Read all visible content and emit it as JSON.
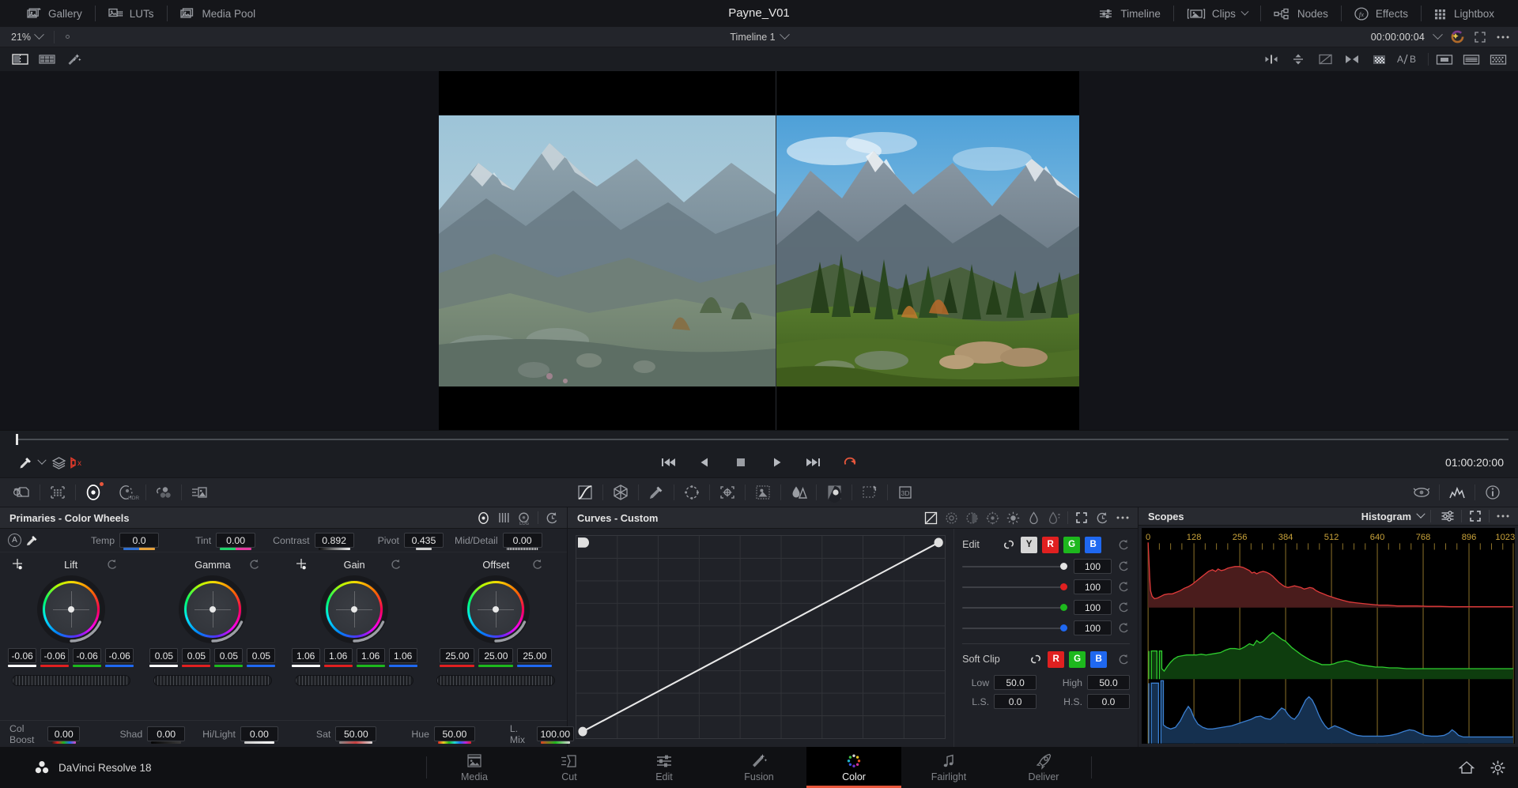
{
  "topbar": {
    "items": [
      {
        "label": "Gallery",
        "icon": "gallery-icon"
      },
      {
        "label": "LUTs",
        "icon": "luts-icon"
      },
      {
        "label": "Media Pool",
        "icon": "media-pool-icon"
      }
    ],
    "project_title": "Payne_V01",
    "right_items": [
      {
        "label": "Timeline",
        "icon": "timeline-icon"
      },
      {
        "label": "Clips",
        "icon": "clips-icon",
        "chevron": true
      },
      {
        "label": "Nodes",
        "icon": "nodes-icon"
      },
      {
        "label": "Effects",
        "icon": "effects-fx-icon"
      },
      {
        "label": "Lightbox",
        "icon": "lightbox-grid-icon"
      }
    ]
  },
  "bar2": {
    "zoom_level": "21%",
    "timeline_name": "Timeline 1",
    "timecode": "00:00:00:04"
  },
  "viewer": {
    "timecode_right": "01:00:20:00"
  },
  "primaries": {
    "title": "Primaries - Color Wheels",
    "mode_label": "A",
    "controls": [
      {
        "name": "Temp",
        "value": "0.0",
        "bar": "temp"
      },
      {
        "name": "Tint",
        "value": "0.00",
        "bar": "tint"
      },
      {
        "name": "Contrast",
        "value": "0.892",
        "bar": "mono"
      },
      {
        "name": "Pivot",
        "value": "0.435",
        "bar": "mono"
      },
      {
        "name": "Mid/Detail",
        "value": "0.00",
        "bar": "ribbed"
      }
    ],
    "wheels": [
      {
        "name": "Lift",
        "values": [
          "-0.06",
          "-0.06",
          "-0.06",
          "-0.06"
        ],
        "colors": [
          "#ffffff",
          "#e02020",
          "#1db81d",
          "#1f68f0"
        ],
        "crosshair": true
      },
      {
        "name": "Gamma",
        "values": [
          "0.05",
          "0.05",
          "0.05",
          "0.05"
        ],
        "colors": [
          "#ffffff",
          "#e02020",
          "#1db81d",
          "#1f68f0"
        ],
        "crosshair": false
      },
      {
        "name": "Gain",
        "values": [
          "1.06",
          "1.06",
          "1.06",
          "1.06"
        ],
        "colors": [
          "#ffffff",
          "#e02020",
          "#1db81d",
          "#1f68f0"
        ],
        "crosshair": true
      },
      {
        "name": "Offset",
        "values": [
          "25.00",
          "25.00",
          "25.00"
        ],
        "colors": [
          "#e02020",
          "#1db81d",
          "#1f68f0"
        ],
        "crosshair": false
      }
    ],
    "bottom_controls": [
      {
        "name": "Col Boost",
        "value": "0.00",
        "bar": "rainbow"
      },
      {
        "name": "Shad",
        "value": "0.00",
        "bar": "dark"
      },
      {
        "name": "Hi/Light",
        "value": "0.00",
        "bar": "light"
      },
      {
        "name": "Sat",
        "value": "50.00",
        "bar": "sat"
      },
      {
        "name": "Hue",
        "value": "50.00",
        "bar": "hue"
      },
      {
        "name": "L. Mix",
        "value": "100.00",
        "bar": "lmix"
      }
    ]
  },
  "curves": {
    "title": "Curves - Custom",
    "edit_label": "Edit",
    "channels": [
      "Y",
      "R",
      "G",
      "B"
    ],
    "sliders": [
      {
        "channel": "Y",
        "value": "100",
        "knob_color": "#e4e4e4",
        "pos": 100
      },
      {
        "channel": "R",
        "value": "100",
        "knob_color": "#e02020",
        "pos": 100
      },
      {
        "channel": "G",
        "value": "100",
        "knob_color": "#1db81d",
        "pos": 100
      },
      {
        "channel": "B",
        "value": "100",
        "knob_color": "#1f68f0",
        "pos": 100
      }
    ],
    "soft_clip_label": "Soft Clip",
    "soft_clip_channels": [
      "R",
      "G",
      "B"
    ],
    "soft_clip_fields": [
      {
        "label": "Low",
        "value": "50.0"
      },
      {
        "label": "High",
        "value": "50.0"
      },
      {
        "label": "L.S.",
        "value": "0.0"
      },
      {
        "label": "H.S.",
        "value": "0.0"
      }
    ]
  },
  "scopes": {
    "title": "Scopes",
    "selected_scope": "Histogram",
    "chart_data": {
      "type": "line",
      "title": "Histogram",
      "xlabel": "",
      "ylabel": "",
      "xlim": [
        0,
        1023
      ],
      "tick_labels": [
        "0",
        "128",
        "256",
        "384",
        "512",
        "640",
        "768",
        "896",
        "1023"
      ],
      "tick_values": [
        0,
        128,
        256,
        384,
        512,
        640,
        768,
        896,
        1023
      ],
      "grid": true,
      "legend_position": "none",
      "series": [
        {
          "name": "Red",
          "color": "#e03a3a"
        },
        {
          "name": "Green",
          "color": "#2ecc2e"
        },
        {
          "name": "Blue",
          "color": "#3a7ed0"
        }
      ]
    }
  },
  "statusbar": {
    "app_name": "DaVinci Resolve 18",
    "pages": [
      {
        "label": "Media",
        "active": false
      },
      {
        "label": "Cut",
        "active": false
      },
      {
        "label": "Edit",
        "active": false
      },
      {
        "label": "Fusion",
        "active": false
      },
      {
        "label": "Color",
        "active": true
      },
      {
        "label": "Fairlight",
        "active": false
      },
      {
        "label": "Deliver",
        "active": false
      }
    ]
  }
}
